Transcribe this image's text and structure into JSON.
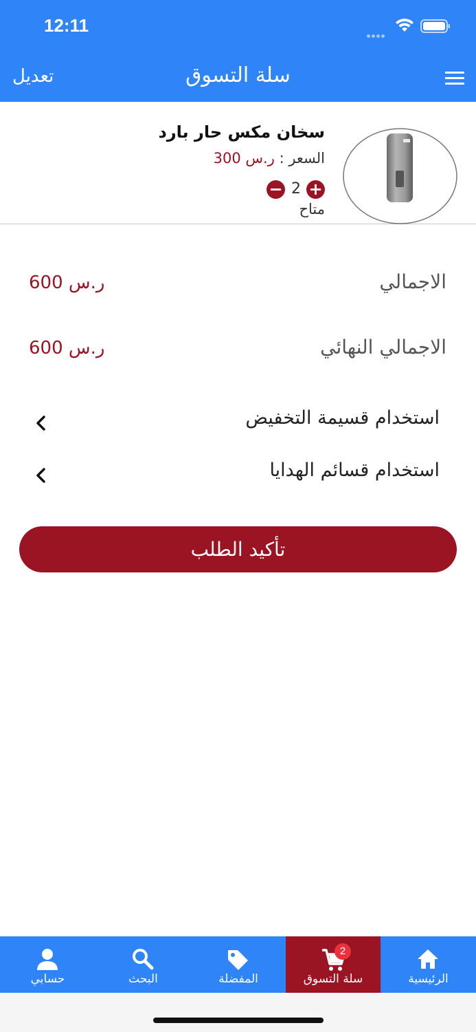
{
  "status_bar": {
    "time": "12:11"
  },
  "nav": {
    "title": "سلة التسوق",
    "edit": "تعديل"
  },
  "product": {
    "name": "سخان مكس حار بارد",
    "price_label": "السعر :",
    "price_value": "ر.س 300",
    "quantity": "2",
    "availability": "متاح"
  },
  "totals": {
    "total_label": "الاجمالي",
    "total_value": "ر.س 600",
    "final_label": "الاجمالي النهائي",
    "final_value": "ر.س 600"
  },
  "options": {
    "discount": "استخدام قسيمة التخفيض",
    "gift": "استخدام قسائم الهدايا"
  },
  "confirm_button": "تأكيد الطلب",
  "tabbar": {
    "account": "حسابي",
    "search": "البحث",
    "favorites": "المفضلة",
    "cart": "سلة التسوق",
    "cart_badge": "2",
    "home": "الرئيسية"
  },
  "colors": {
    "primary": "#2f84f7",
    "accent": "#9b1424",
    "badge": "#e8333f"
  }
}
